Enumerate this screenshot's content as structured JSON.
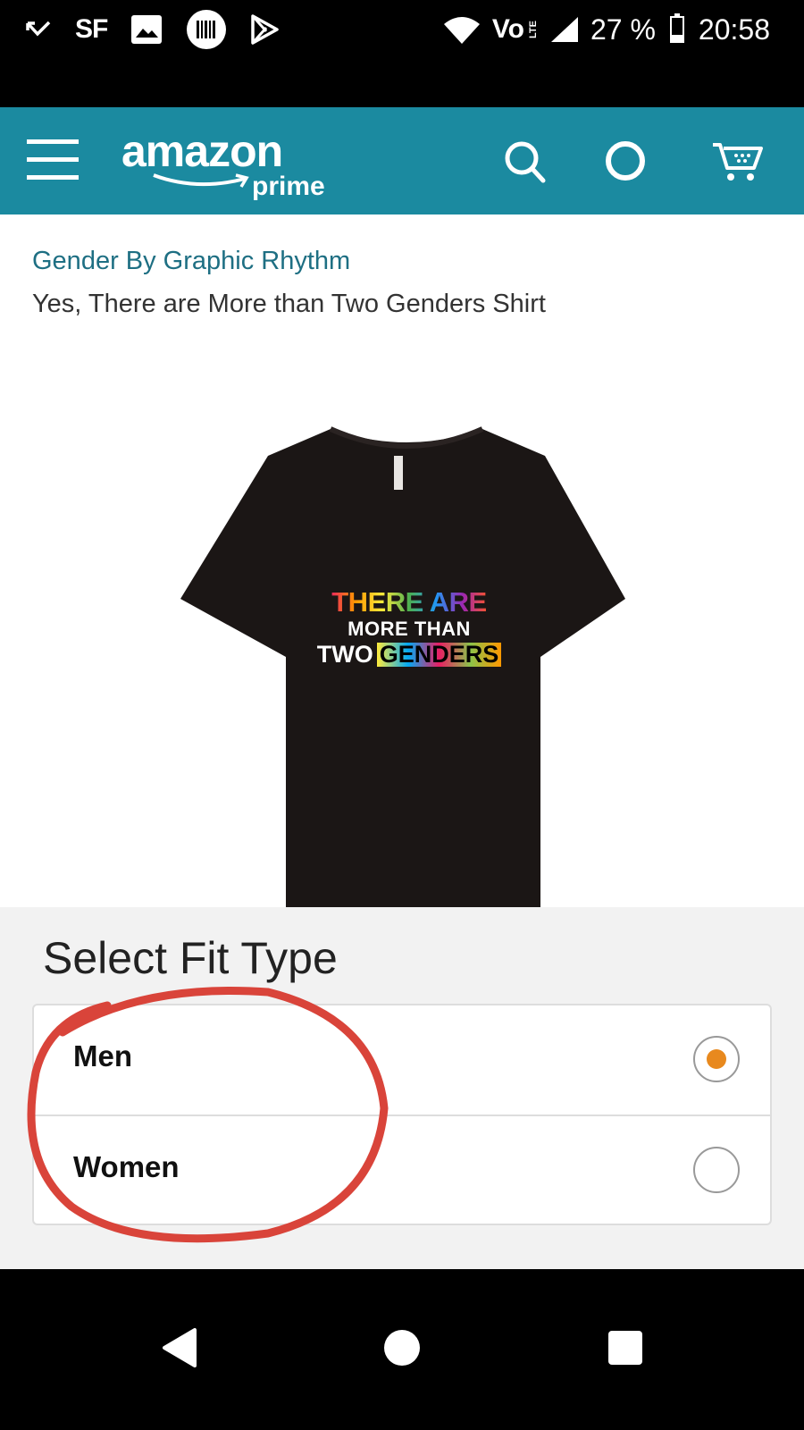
{
  "status_bar": {
    "carrier": "SF",
    "network": "Vo",
    "network_sub": "LTE",
    "battery_percent": "27 %",
    "battery_level": 0.27,
    "time": "20:58"
  },
  "header": {
    "logo_text": "amazon",
    "logo_sub": "prime",
    "icons": [
      "menu-icon",
      "search-icon",
      "alexa-icon",
      "cart-icon"
    ]
  },
  "product": {
    "brand": "Gender By Graphic Rhythm",
    "title": "Yes, There are More than Two Genders Shirt",
    "print": {
      "line1": "THERE ARE",
      "line2": "MORE THAN",
      "line3a": "TWO",
      "line3b": "GENDERS"
    }
  },
  "fit": {
    "heading": "Select Fit Type",
    "options": [
      {
        "label": "Men",
        "selected": true
      },
      {
        "label": "Women",
        "selected": false
      }
    ]
  },
  "colors": {
    "header": "#1b8aa0",
    "brand_link": "#1e6f83",
    "radio_selected": "#e8891e",
    "annotation": "#d9443a",
    "shirt": "#1b1615"
  }
}
